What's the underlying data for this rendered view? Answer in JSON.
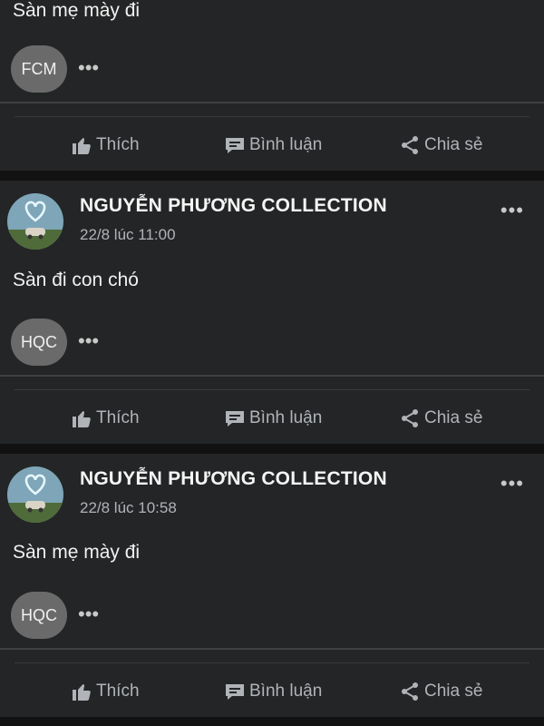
{
  "posts": [
    {
      "text": "Sàn mẹ mày đi",
      "reply_badge": "FCM",
      "reply_more": "•••"
    },
    {
      "author": "NGUYỄN PHƯƠNG COLLECTION",
      "timestamp": "22/8 lúc 11:00",
      "more": "•••",
      "text": "Sàn đi con chó",
      "reply_badge": "HQC",
      "reply_more": "•••"
    },
    {
      "author": "NGUYỄN PHƯƠNG COLLECTION",
      "timestamp": "22/8 lúc 10:58",
      "more": "•••",
      "text": "Sàn mẹ mày đi",
      "reply_badge": "HQC",
      "reply_more": "•••"
    }
  ],
  "actions": {
    "like": "Thích",
    "comment": "Bình luận",
    "share": "Chia sẻ"
  },
  "colors": {
    "background": "#121212",
    "card": "#242526",
    "muted_text": "#b0b3b8",
    "badge": "#6a6a6a"
  },
  "icons": {
    "like": "thumbs-up-icon",
    "comment": "comment-bubble-icon",
    "share": "share-icon"
  }
}
